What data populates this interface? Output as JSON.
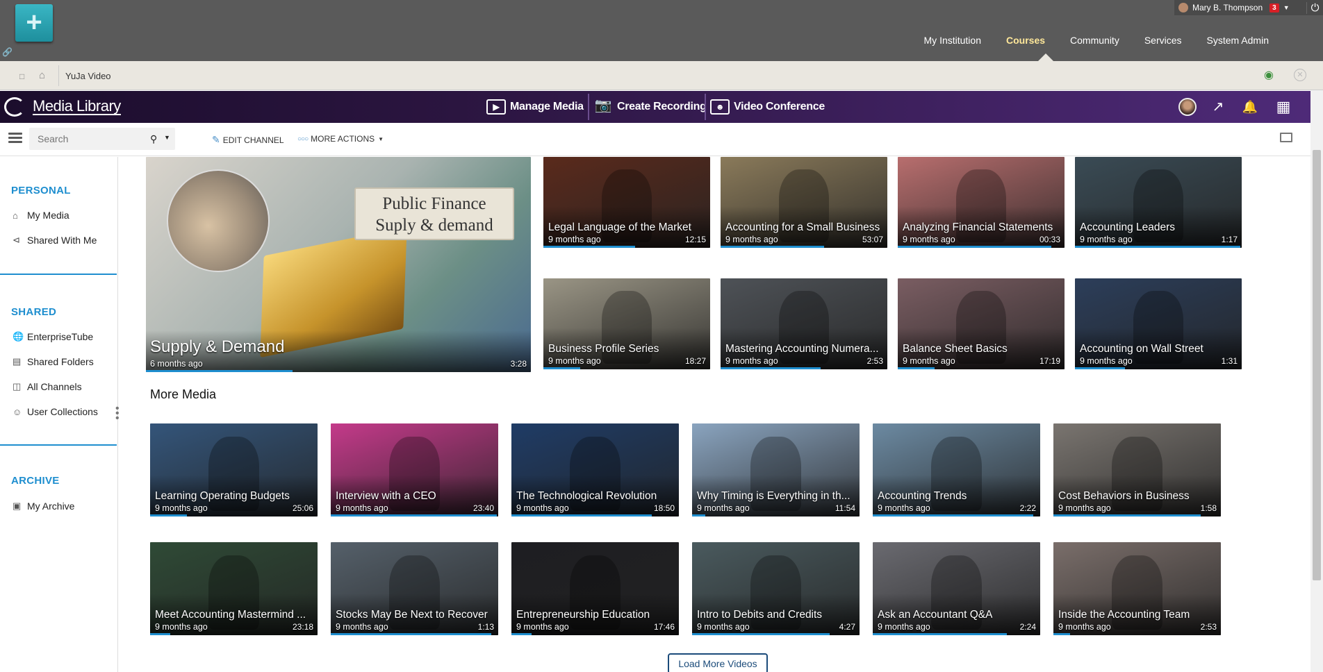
{
  "lms": {
    "plus_label": "+",
    "user": {
      "name": "Mary B. Thompson",
      "badge": "3"
    },
    "nav": [
      "My Institution",
      "Courses",
      "Community",
      "Services",
      "System Admin"
    ],
    "active_nav": "Courses"
  },
  "breadcrumb": {
    "title": "YuJa Video"
  },
  "header": {
    "title": "Media Library",
    "actions": {
      "manage": "Manage Media",
      "record": "Create Recording",
      "conference": "Video Conference"
    }
  },
  "toolbar": {
    "search_placeholder": "Search",
    "edit_channel": "EDIT CHANNEL",
    "more_actions": "MORE ACTIONS"
  },
  "sidebar": {
    "personal": {
      "heading": "PERSONAL",
      "items": [
        "My Media",
        "Shared With Me"
      ]
    },
    "shared": {
      "heading": "SHARED",
      "items": [
        "EnterpriseTube",
        "Shared Folders",
        "All Channels",
        "User Collections"
      ]
    },
    "archive": {
      "heading": "ARCHIVE",
      "items": [
        "My Archive"
      ]
    }
  },
  "featured": {
    "title": "Supply & Demand",
    "age": "6 months ago",
    "duration": "3:28",
    "card_line1": "Public Finance",
    "card_line2": "Suply & demand",
    "progress": 0.38
  },
  "top_grid": [
    {
      "title": "Legal Language of the Market",
      "age": "9 months ago",
      "duration": "12:15",
      "progress": 0.55,
      "bg": "#5a2a1c"
    },
    {
      "title": "Accounting for a Small Business",
      "age": "9 months ago",
      "duration": "53:07",
      "progress": 0.62,
      "bg": "#8a7a5a"
    },
    {
      "title": "Analyzing Financial Statements",
      "age": "9 months ago",
      "duration": "00:33",
      "progress": 0.92,
      "bg": "#b86e6e"
    },
    {
      "title": "Accounting Leaders",
      "age": "9 months ago",
      "duration": "1:17",
      "progress": 0.99,
      "bg": "#3a4b55"
    },
    {
      "title": "Business Profile Series",
      "age": "9 months ago",
      "duration": "18:27",
      "progress": 0.22,
      "bg": "#9a9585"
    },
    {
      "title": "Mastering Accounting Numera...",
      "age": "9 months ago",
      "duration": "2:53",
      "progress": 0.6,
      "bg": "#4e5257"
    },
    {
      "title": "Balance Sheet Basics",
      "age": "9 months ago",
      "duration": "17:19",
      "progress": 0.22,
      "bg": "#7a5d62"
    },
    {
      "title": "Accounting on Wall Street",
      "age": "9 months ago",
      "duration": "1:31",
      "progress": 0.3,
      "bg": "#2c3e5a"
    }
  ],
  "more_media": {
    "title": "More Media",
    "load_more": "Load More Videos",
    "items": [
      {
        "title": "Learning Operating Budgets",
        "age": "9 months ago",
        "duration": "25:06",
        "progress": 0.22,
        "bg": "#34557a"
      },
      {
        "title": "Interview with a CEO",
        "age": "9 months ago",
        "duration": "23:40",
        "progress": 0.99,
        "bg": "#c43a8a"
      },
      {
        "title": "The Technological Revolution",
        "age": "9 months ago",
        "duration": "18:50",
        "progress": 0.84,
        "bg": "#1f3c66"
      },
      {
        "title": "Why Timing is Everything in th...",
        "age": "9 months ago",
        "duration": "11:54",
        "progress": 0.08,
        "bg": "#8aa4bf"
      },
      {
        "title": "Accounting Trends",
        "age": "9 months ago",
        "duration": "2:22",
        "progress": 0.96,
        "bg": "#6c8aa2"
      },
      {
        "title": "Cost Behaviors in Business",
        "age": "9 months ago",
        "duration": "1:58",
        "progress": 0.88,
        "bg": "#7a7570"
      },
      {
        "title": "Meet Accounting Mastermind ...",
        "age": "9 months ago",
        "duration": "23:18",
        "progress": 0.12,
        "bg": "#2f4a36"
      },
      {
        "title": "Stocks May Be Next to Recover",
        "age": "9 months ago",
        "duration": "1:13",
        "progress": 0.96,
        "bg": "#55606a"
      },
      {
        "title": "Entrepreneurship Education",
        "age": "9 months ago",
        "duration": "17:46",
        "progress": 0.12,
        "bg": "#1e1e22"
      },
      {
        "title": "Intro to Debits and Credits",
        "age": "9 months ago",
        "duration": "4:27",
        "progress": 0.82,
        "bg": "#4a5a5e"
      },
      {
        "title": "Ask an Accountant Q&A",
        "age": "9 months ago",
        "duration": "2:24",
        "progress": 0.8,
        "bg": "#6a6a70"
      },
      {
        "title": "Inside the Accounting Team",
        "age": "9 months ago",
        "duration": "2:53",
        "progress": 0.1,
        "bg": "#7a6e6a"
      }
    ]
  }
}
